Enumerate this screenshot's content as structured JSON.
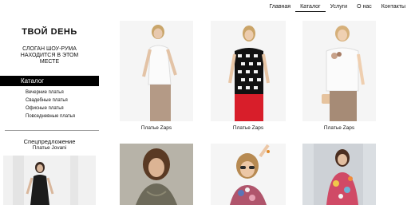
{
  "nav": [
    {
      "label": "Главная",
      "active": false
    },
    {
      "label": "Каталог",
      "active": true
    },
    {
      "label": "Услуги",
      "active": false
    },
    {
      "label": "О нас",
      "active": false
    },
    {
      "label": "Контакты",
      "active": false
    }
  ],
  "sidebar": {
    "brand": "ТВОЙ DEНЬ",
    "slogan": "СЛОГАН ШОУ-РУМА НАХОДИТСЯ В ЭТОМ МЕСТЕ",
    "catalog_heading": "Каталог",
    "catalog_items": [
      "Вечерние платья",
      "Свадебные платья",
      "Офисные платья",
      "Повседневные платья"
    ],
    "special_title": "Спецпредложение",
    "special_item": "Платье Jovani"
  },
  "products": [
    {
      "caption": "Платье Zaps"
    },
    {
      "caption": "Платье Zaps"
    },
    {
      "caption": "Платье Zaps"
    },
    {
      "caption": ""
    },
    {
      "caption": ""
    },
    {
      "caption": ""
    }
  ]
}
